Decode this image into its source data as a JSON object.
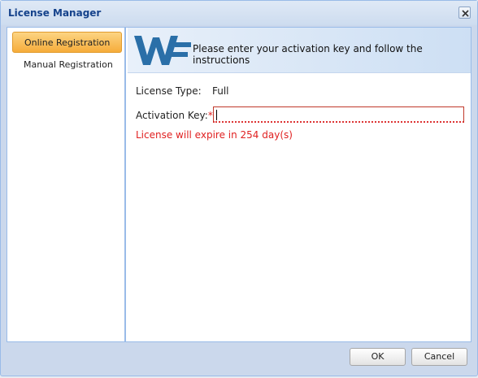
{
  "window": {
    "title": "License Manager"
  },
  "sidebar": {
    "items": [
      {
        "label": "Online Registration",
        "active": true
      },
      {
        "label": "Manual Registration",
        "active": false
      }
    ]
  },
  "banner": {
    "logo_text": "WF",
    "message": "Please enter your activation key and follow the instructions"
  },
  "form": {
    "license_type_label": "License Type:",
    "license_type_value": "Full",
    "activation_key_label": "Activation Key:",
    "required_marker": "*",
    "activation_key_value": "",
    "expiry_message": "License will expire in 254 day(s)"
  },
  "buttons": {
    "ok": "OK",
    "cancel": "Cancel"
  },
  "colors": {
    "accent": "#f6ac3a",
    "border": "#99bbe8",
    "error": "#e02020",
    "logo": "#2a6fa8"
  }
}
